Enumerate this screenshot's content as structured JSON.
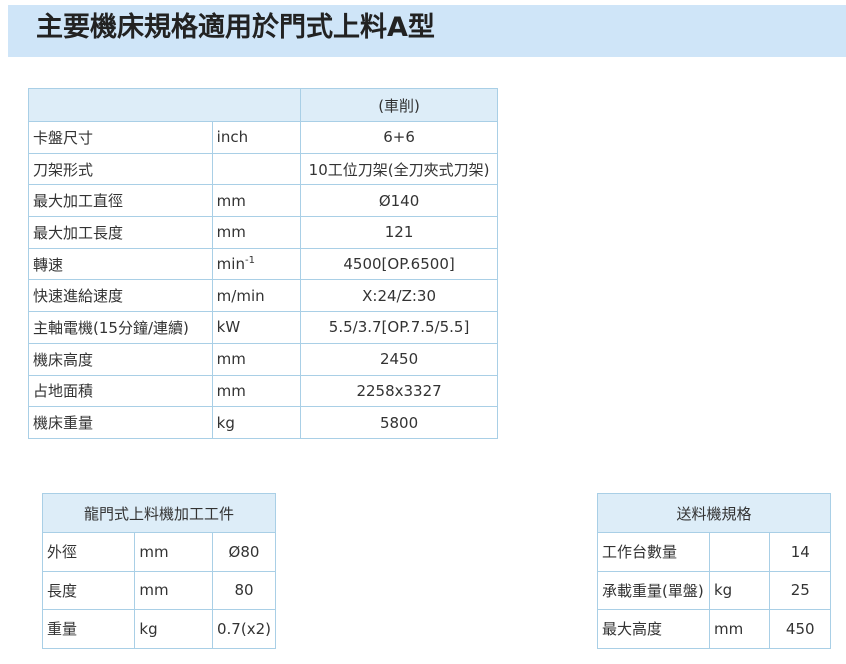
{
  "page": {
    "title": "主要機床規格適用於門式上料A型"
  },
  "main_table": {
    "column_header": "(車削)",
    "rows": [
      {
        "label": "卡盤尺寸",
        "unit": "inch",
        "unit_sup": "",
        "value": "6+6"
      },
      {
        "label": "刀架形式",
        "unit": "",
        "unit_sup": "",
        "value": "10工位刀架(全刀夾式刀架)"
      },
      {
        "label": "最大加工直徑",
        "unit": "mm",
        "unit_sup": "",
        "value": "Ø140"
      },
      {
        "label": "最大加工長度",
        "unit": "mm",
        "unit_sup": "",
        "value": "121"
      },
      {
        "label": "轉速",
        "unit": "min",
        "unit_sup": "-1",
        "value": "4500[OP.6500]"
      },
      {
        "label": "快速進給速度",
        "unit": "m/min",
        "unit_sup": "",
        "value": "X:24/Z:30"
      },
      {
        "label": "主軸電機(15分鐘/連續)",
        "unit": "kW",
        "unit_sup": "",
        "value": "5.5/3.7[OP.7.5/5.5]"
      },
      {
        "label": "機床高度",
        "unit": "mm",
        "unit_sup": "",
        "value": "2450"
      },
      {
        "label": "占地面積",
        "unit": "mm",
        "unit_sup": "",
        "value": "2258x3327"
      },
      {
        "label": "機床重量",
        "unit": "kg",
        "unit_sup": "",
        "value": "5800"
      }
    ]
  },
  "workpiece_table": {
    "header": "龍門式上料機加工工件",
    "rows": [
      {
        "label": "外徑",
        "unit": "mm",
        "value": "Ø80"
      },
      {
        "label": "長度",
        "unit": "mm",
        "value": "80"
      },
      {
        "label": "重量",
        "unit": "kg",
        "value": "0.7(x2)"
      }
    ]
  },
  "feeder_table": {
    "header": "送料機規格",
    "rows": [
      {
        "label": "工作台數量",
        "unit": "",
        "value": "14"
      },
      {
        "label": "承載重量(單盤)",
        "unit": "kg",
        "value": "25"
      },
      {
        "label": "最大高度",
        "unit": "mm",
        "value": "450"
      }
    ]
  },
  "colors": {
    "banner_bg": "#cfe5f8",
    "header_cell_bg": "#ddedf8",
    "border": "#a9cfe6",
    "text": "#333333"
  }
}
